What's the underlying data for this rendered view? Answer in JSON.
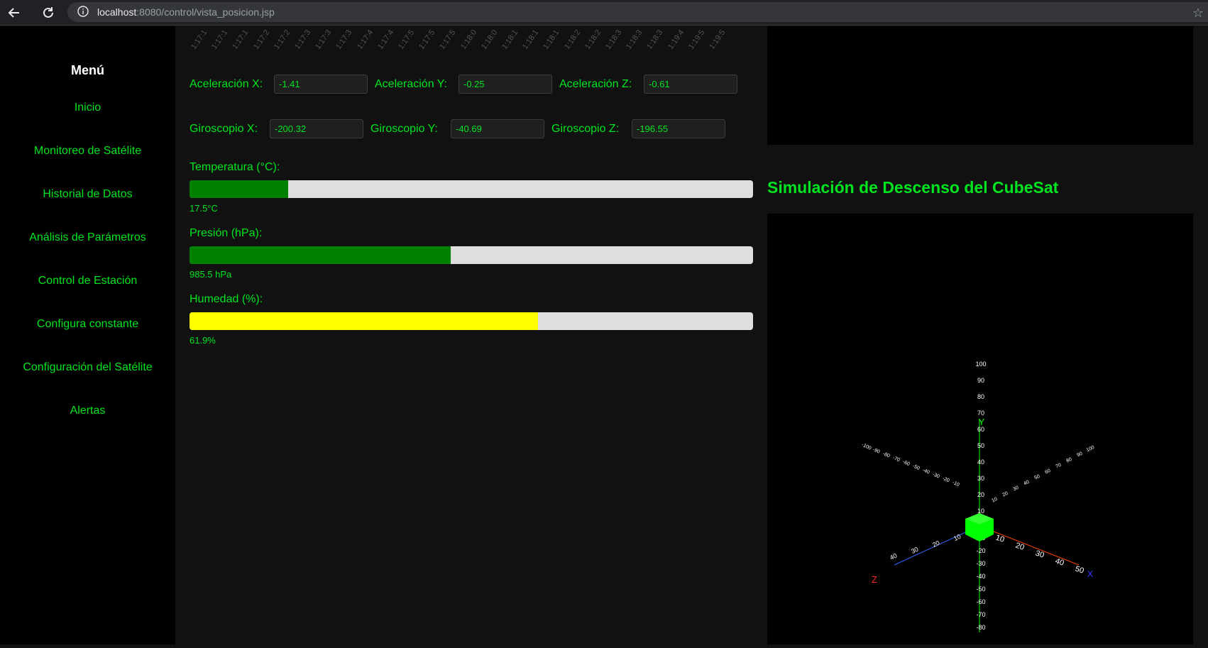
{
  "browser": {
    "url_host": "localhost",
    "url_rest": ":8080/control/vista_posicion.jsp"
  },
  "sidebar": {
    "title": "Menú",
    "items": [
      {
        "label": "Inicio"
      },
      {
        "label": "Monitoreo de Satélite"
      },
      {
        "label": "Historial de Datos"
      },
      {
        "label": "Análisis de Parámetros"
      },
      {
        "label": "Control de Estación"
      },
      {
        "label": "Configura constante"
      },
      {
        "label": "Configuración del Satélite"
      },
      {
        "label": "Alertas"
      }
    ]
  },
  "time_ticks": [
    "1:17:1",
    "1:17:1",
    "1:17:1",
    "1:17:2",
    "1:17:2",
    "1:17:3",
    "1:17:3",
    "1:17:3",
    "1:17:4",
    "1:17:4",
    "1:17:5",
    "1:17:5",
    "1:17:5",
    "1:18:0",
    "1:18:0",
    "1:18:1",
    "1:18:1",
    "1:18:1",
    "1:18:2",
    "1:18:2",
    "1:18:3",
    "1:18:3",
    "1:18:3",
    "1:19:4",
    "1:19:5",
    "1:19:5"
  ],
  "acceleration": {
    "x_label": "Aceleración X:",
    "x_value": "-1.41",
    "y_label": "Aceleración Y:",
    "y_value": "-0.25",
    "z_label": "Aceleración Z:",
    "z_value": "-0.61"
  },
  "gyroscope": {
    "x_label": "Giroscopio X:",
    "x_value": "-200.32",
    "y_label": "Giroscopio Y:",
    "y_value": "-40.69",
    "z_label": "Giroscopio Z:",
    "z_value": "-196.55"
  },
  "sensors": {
    "temperature": {
      "label": "Temperatura (°C):",
      "value_text": "17.5°C",
      "fill_fraction": 0.175,
      "color": "#008000"
    },
    "pressure": {
      "label": "Presión (hPa):",
      "value_text": "985.5 hPa",
      "fill_fraction": 0.464,
      "color": "#008000"
    },
    "humidity": {
      "label": "Humedad (%):",
      "value_text": "61.9%",
      "fill_fraction": 0.619,
      "color": "#ffff00"
    }
  },
  "simulation": {
    "title": "Simulación de Descenso del CubeSat",
    "y_axis_ticks": [
      "100",
      "90",
      "80",
      "70",
      "60",
      "50",
      "40",
      "30",
      "20",
      "10",
      "-10",
      "-20",
      "-30",
      "-40",
      "-50",
      "-60",
      "-70",
      "-80"
    ],
    "x_axis_ticks": [
      "10",
      "20",
      "30",
      "40",
      "50"
    ],
    "z_axis_ticks": [
      "10",
      "20",
      "30",
      "40"
    ],
    "back_left_ticks": [
      "-100",
      "-90",
      "-80",
      "-70",
      "-60",
      "-50",
      "-40",
      "-30",
      "-20",
      "-10"
    ],
    "back_right_ticks": [
      "10",
      "20",
      "30",
      "40",
      "50",
      "60",
      "70",
      "80",
      "90",
      "100"
    ],
    "axis_labels": {
      "x": "X",
      "y": "Y",
      "z": "Z"
    },
    "cube_color": "#00ff00",
    "x_axis_color": "#ff4400",
    "y_axis_color": "#00ff00",
    "z_axis_color": "#3366ff"
  },
  "colors": {
    "accent": "#00e51f",
    "sidebar_bg": "#000000",
    "main_bg": "#111111"
  }
}
